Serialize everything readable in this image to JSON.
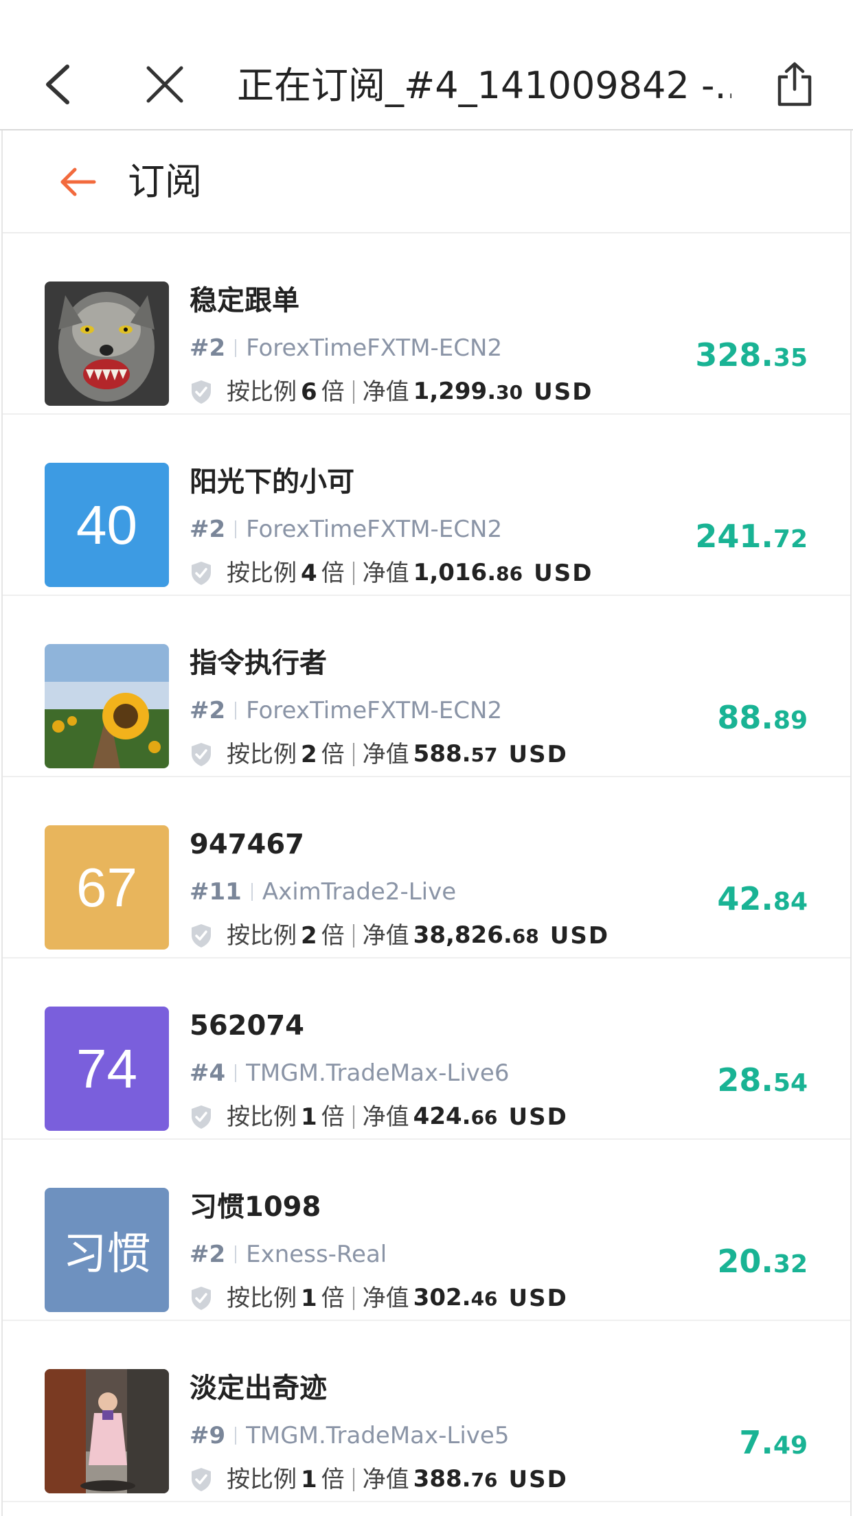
{
  "browser": {
    "title": "正在订阅_#4_141009842 -...",
    "icons": [
      "back-arrow-icon",
      "close-icon",
      "share-icon"
    ]
  },
  "header": {
    "title": "订阅",
    "accent_color": "#f26a3d"
  },
  "rows": [
    {
      "name": "稳定跟单",
      "rank": "#2",
      "server": "ForexTimeFXTM-ECN2",
      "ratio_label": "按比例",
      "ratio": "6",
      "ratio_unit": "倍",
      "equity_label": "净值",
      "equity_int": "1,299.",
      "equity_dec": "30",
      "currency": "USD",
      "profit_int": "328.",
      "profit_dec": "35",
      "avatar": {
        "type": "image",
        "desc": "wolf"
      }
    },
    {
      "name": "阳光下的小可",
      "rank": "#2",
      "server": "ForexTimeFXTM-ECN2",
      "ratio_label": "按比例",
      "ratio": "4",
      "ratio_unit": "倍",
      "equity_label": "净值",
      "equity_int": "1,016.",
      "equity_dec": "86",
      "currency": "USD",
      "profit_int": "241.",
      "profit_dec": "72",
      "avatar": {
        "type": "text",
        "text": "40",
        "color": "#3d9be3"
      }
    },
    {
      "name": "指令执行者",
      "rank": "#2",
      "server": "ForexTimeFXTM-ECN2",
      "ratio_label": "按比例",
      "ratio": "2",
      "ratio_unit": "倍",
      "equity_label": "净值",
      "equity_int": "588.",
      "equity_dec": "57",
      "currency": "USD",
      "profit_int": "88.",
      "profit_dec": "89",
      "avatar": {
        "type": "image",
        "desc": "sunflower"
      }
    },
    {
      "name": "947467",
      "rank": "#11",
      "server": "AximTrade2-Live",
      "ratio_label": "按比例",
      "ratio": "2",
      "ratio_unit": "倍",
      "equity_label": "净值",
      "equity_int": "38,826.",
      "equity_dec": "68",
      "currency": "USD",
      "profit_int": "42.",
      "profit_dec": "84",
      "avatar": {
        "type": "text",
        "text": "67",
        "color": "#e8b55c"
      }
    },
    {
      "name": "562074",
      "rank": "#4",
      "server": "TMGM.TradeMax-Live6",
      "ratio_label": "按比例",
      "ratio": "1",
      "ratio_unit": "倍",
      "equity_label": "净值",
      "equity_int": "424.",
      "equity_dec": "66",
      "currency": "USD",
      "profit_int": "28.",
      "profit_dec": "54",
      "avatar": {
        "type": "text",
        "text": "74",
        "color": "#7a5fdc"
      }
    },
    {
      "name": "习惯1098",
      "rank": "#2",
      "server": "Exness-Real",
      "ratio_label": "按比例",
      "ratio": "1",
      "ratio_unit": "倍",
      "equity_label": "净值",
      "equity_int": "302.",
      "equity_dec": "46",
      "currency": "USD",
      "profit_int": "20.",
      "profit_dec": "32",
      "avatar": {
        "type": "text",
        "text": "习惯",
        "color": "#6e91bf"
      }
    },
    {
      "name": "淡定出奇迹",
      "rank": "#9",
      "server": "TMGM.TradeMax-Live5",
      "ratio_label": "按比例",
      "ratio": "1",
      "ratio_unit": "倍",
      "equity_label": "净值",
      "equity_int": "388.",
      "equity_dec": "76",
      "currency": "USD",
      "profit_int": "7.",
      "profit_dec": "49",
      "avatar": {
        "type": "image",
        "desc": "person"
      }
    }
  ],
  "colors": {
    "profit": "#19b394",
    "text": "#222222",
    "muted": "#8a94a6"
  }
}
